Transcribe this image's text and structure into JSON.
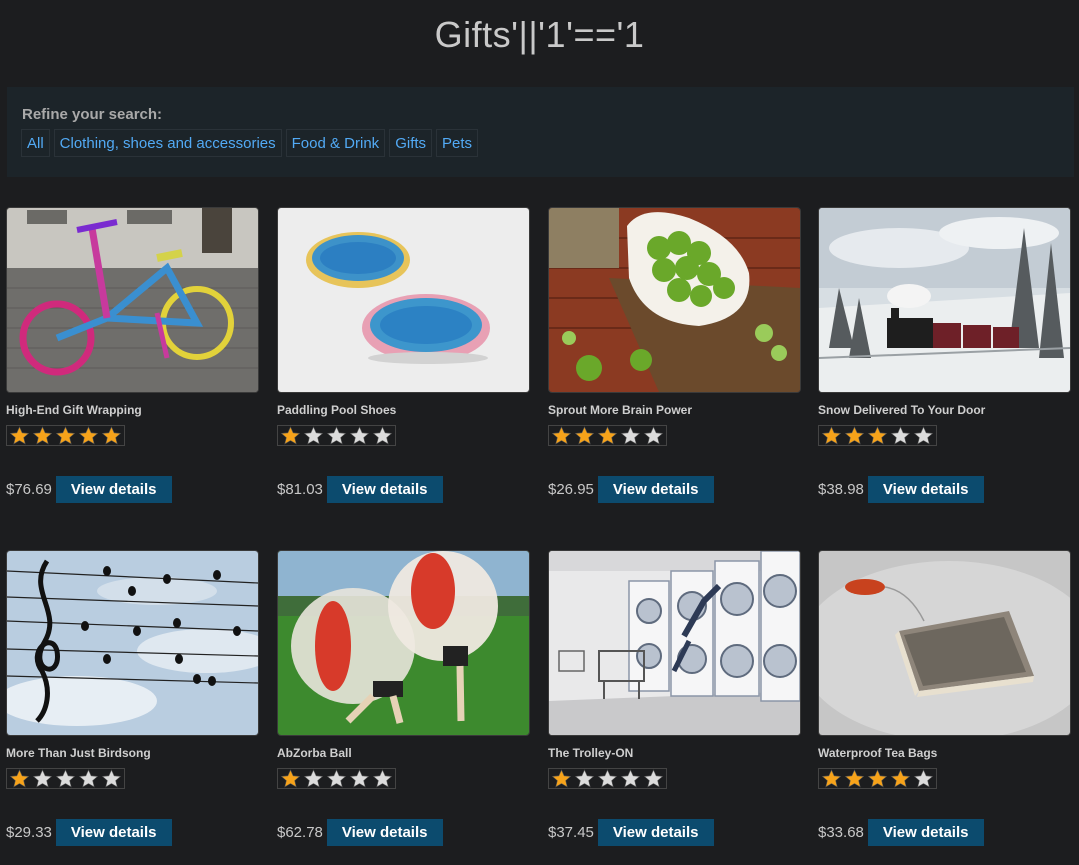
{
  "page_title": "Gifts'||'1'=='1",
  "refine": {
    "label": "Refine your search:",
    "categories": [
      "All",
      "Clothing, shoes and accessories",
      "Food & Drink",
      "Gifts",
      "Pets"
    ]
  },
  "colors": {
    "accent_link": "#52aaf5",
    "button_bg": "#0c4b6e",
    "star_on": "#f7a31a",
    "star_off": "#dcdcdc"
  },
  "products": [
    {
      "name": "High-End Gift Wrapping",
      "rating": 5,
      "price": "$76.69",
      "button": "View details",
      "image": "yarn-bike-image"
    },
    {
      "name": "Paddling Pool Shoes",
      "rating": 1,
      "price": "$81.03",
      "button": "View details",
      "image": "paddling-pools-image"
    },
    {
      "name": "Sprout More Brain Power",
      "rating": 3,
      "price": "$26.95",
      "button": "View details",
      "image": "sprouts-image"
    },
    {
      "name": "Snow Delivered To Your Door",
      "rating": 3,
      "price": "$38.98",
      "button": "View details",
      "image": "snow-train-image"
    },
    {
      "name": "More Than Just Birdsong",
      "rating": 1,
      "price": "$29.33",
      "button": "View details",
      "image": "birds-music-staff-image"
    },
    {
      "name": "AbZorba Ball",
      "rating": 1,
      "price": "$62.78",
      "button": "View details",
      "image": "bubble-ball-image"
    },
    {
      "name": "The Trolley-ON",
      "rating": 1,
      "price": "$37.45",
      "button": "View details",
      "image": "laundromat-image"
    },
    {
      "name": "Waterproof Tea Bags",
      "rating": 4,
      "price": "$33.68",
      "button": "View details",
      "image": "tea-bag-image"
    }
  ]
}
